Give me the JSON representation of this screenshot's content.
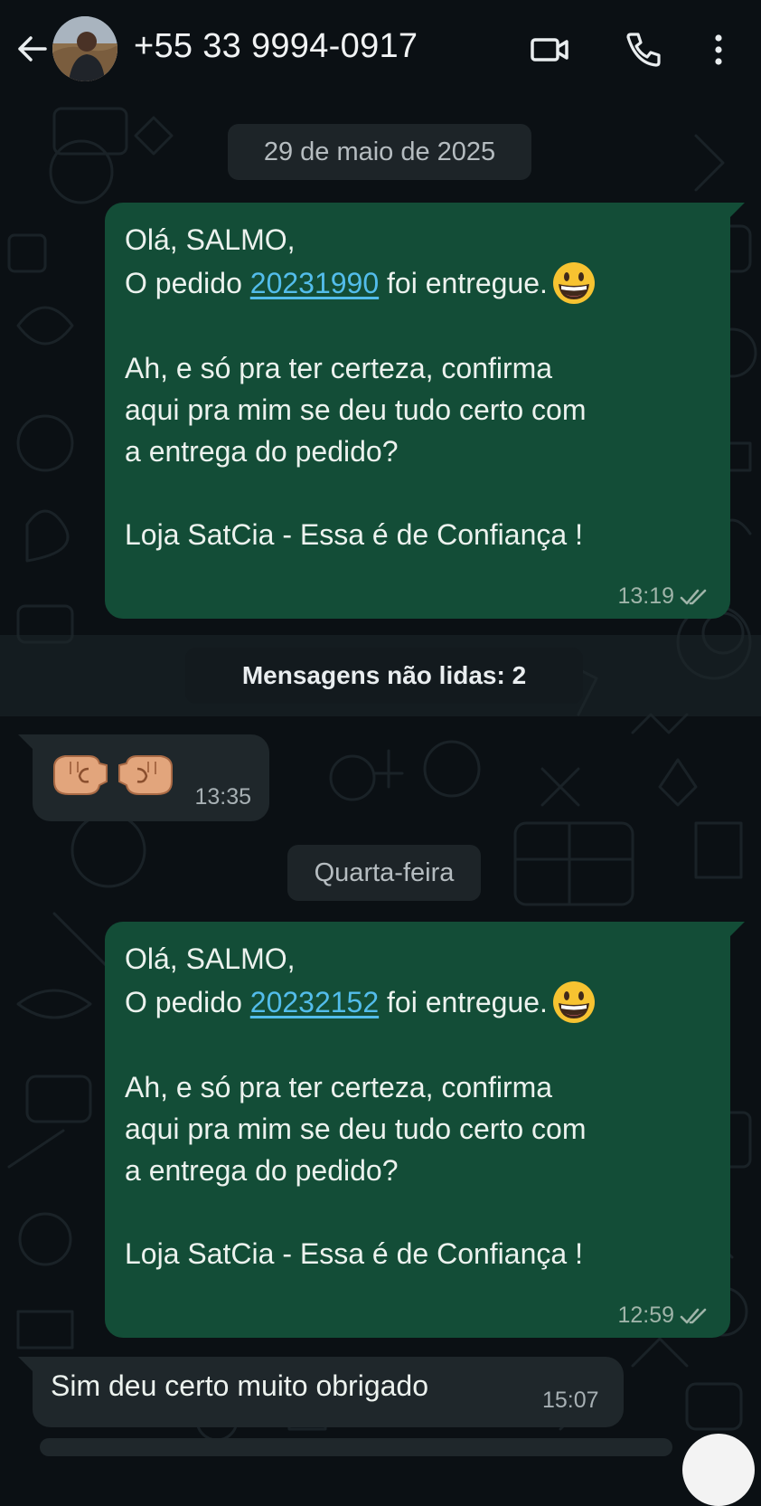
{
  "header": {
    "back_icon": "arrow-left-icon",
    "contact": "+55 33 9994-0917",
    "icons": [
      "video-call-icon",
      "phone-icon",
      "kebab-menu-icon"
    ]
  },
  "chat": {
    "date_pill_1": "29 de maio de 2025",
    "message_1": {
      "greeting": "Olá, SALMO,",
      "order_prefix": "O pedido",
      "order_number": "20231990",
      "order_suffix": "foi entregue.",
      "emoji": "grinning-face-emoji",
      "question_line_1": "Ah, e só pra ter certeza, confirma",
      "question_line_2": "aqui pra mim se deu tudo certo com",
      "question_line_3": "a entrega do pedido?",
      "signature": "Loja SatCia - Essa é de Confiança !",
      "time": "13:19",
      "status_icon": "double-check-icon"
    },
    "unread_label": "Mensagens não lidas: 2",
    "message_2": {
      "emoji": "fist-bump-emoji",
      "time": "13:35"
    },
    "date_pill_2": "Quarta-feira",
    "message_3": {
      "greeting": "Olá, SALMO,",
      "order_prefix": "O pedido",
      "order_number": "20232152",
      "order_suffix": "foi entregue.",
      "emoji": "grinning-face-emoji",
      "question_line_1": "Ah, e só pra ter certeza, confirma",
      "question_line_2": "aqui pra mim se deu tudo certo com",
      "question_line_3": "a entrega do pedido?",
      "signature": "Loja SatCia - Essa é de Confiança !",
      "time": "12:59",
      "status_icon": "double-check-icon"
    },
    "message_4": {
      "text": "Sim deu certo muito obrigado",
      "time": "15:07"
    }
  },
  "colors": {
    "background": "#0b1014",
    "outgoing_bubble": "#134d37",
    "incoming_bubble": "#1f272b",
    "link": "#53bdeb",
    "pill": "#1d2428"
  }
}
